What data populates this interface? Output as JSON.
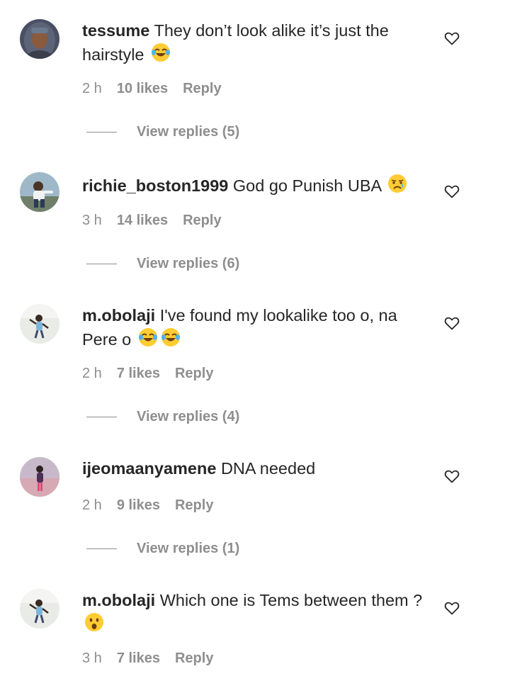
{
  "comments": [
    {
      "username": "tessume",
      "text": "They don’t look alike it’s just the hairstyle",
      "emojis": [
        "😂"
      ],
      "time": "2 h",
      "likes": "10 likes",
      "reply": "Reply",
      "view_replies": "View replies (5)"
    },
    {
      "username": "richie_boston1999",
      "text": "God go Punish UBA",
      "emojis": [
        "😥"
      ],
      "time": "3 h",
      "likes": "14 likes",
      "reply": "Reply",
      "view_replies": "View replies (6)"
    },
    {
      "username": "m.obolaji",
      "text": "I've found my lookalike too o, na Pere o",
      "emojis": [
        "😂",
        "😂"
      ],
      "time": "2 h",
      "likes": "7 likes",
      "reply": "Reply",
      "view_replies": "View replies (4)"
    },
    {
      "username": "ijeomaanyamene",
      "text": "DNA needed",
      "emojis": [],
      "time": "2 h",
      "likes": "9 likes",
      "reply": "Reply",
      "view_replies": "View replies (1)"
    },
    {
      "username": "m.obolaji",
      "text": "Which one is Tems between them ?",
      "emojis": [
        "😮"
      ],
      "time": "3 h",
      "likes": "7 likes",
      "reply": "Reply"
    }
  ],
  "icons": {
    "like": "heart-outline-icon",
    "tears_of_joy": "face-with-tears-of-joy-emoji",
    "sad": "sad-but-relieved-face-emoji",
    "surprised": "face-with-open-mouth-emoji"
  },
  "colors": {
    "primary_text": "#262626",
    "secondary_text": "#8e8e8e",
    "background": "#ffffff"
  }
}
